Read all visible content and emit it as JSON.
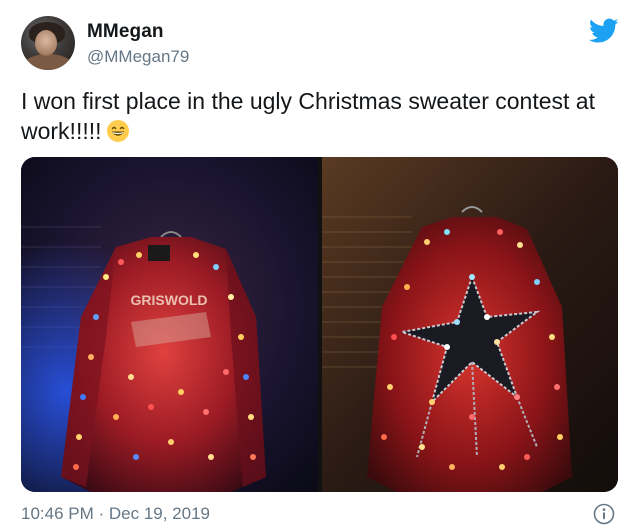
{
  "author": {
    "display_name": "MMegan",
    "handle": "@MMegan79",
    "avatar_icon": "profile-photo"
  },
  "tweet": {
    "text": "I won first place in the ugly Christmas sweater contest at work!!!!!",
    "emoji": "grinning-face-with-smiling-eyes",
    "timestamp": "10:46 PM · Dec 19, 2019"
  },
  "media": {
    "photos": [
      {
        "name": "sweater-photo-1",
        "alt_visible_text": "GRISWOLD"
      },
      {
        "name": "sweater-photo-2"
      }
    ]
  },
  "icons": {
    "brand": "twitter-bird-icon",
    "info": "info-icon"
  },
  "colors": {
    "twitter_blue": "#1da1f2",
    "name_text": "#14171a",
    "secondary_text": "#657786"
  }
}
